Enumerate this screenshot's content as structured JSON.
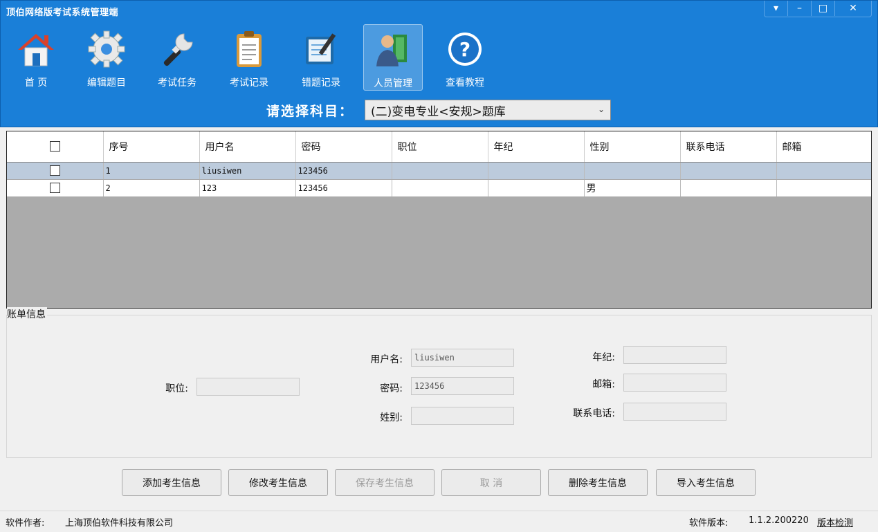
{
  "window": {
    "title": "顶伯网络版考试系统管理端",
    "controls": [
      "▾",
      "–",
      "□",
      "✕"
    ]
  },
  "toolbar": {
    "items": [
      {
        "label": "首  页",
        "icon": "home-icon",
        "active": false
      },
      {
        "label": "编辑题目",
        "icon": "gear-icon",
        "active": false
      },
      {
        "label": "考试任务",
        "icon": "wrench-icon",
        "active": false
      },
      {
        "label": "考试记录",
        "icon": "clipboard-icon",
        "active": false
      },
      {
        "label": "错题记录",
        "icon": "notebook-icon",
        "active": false
      },
      {
        "label": "人员管理",
        "icon": "people-icon",
        "active": true
      },
      {
        "label": "查看教程",
        "icon": "help-icon",
        "active": false
      }
    ]
  },
  "subject": {
    "label": "请选择科目：",
    "selected": "(二)变电专业<安规>题库"
  },
  "grid": {
    "columns": [
      "序号",
      "用户名",
      "密码",
      "职位",
      "年纪",
      "性别",
      "联系电话",
      "邮箱"
    ],
    "rows": [
      {
        "no": "1",
        "username": "liusiwen",
        "password": "123456",
        "position": "",
        "age": "",
        "sex": "",
        "phone": "",
        "email": "",
        "selected": true
      },
      {
        "no": "2",
        "username": "123",
        "password": "123456",
        "position": "",
        "age": "",
        "sex": "男",
        "phone": "",
        "email": "",
        "selected": false
      }
    ]
  },
  "account": {
    "group_label": "账单信息",
    "position_label": "职位:",
    "username_label": "用户名:",
    "username_value": "liusiwen",
    "password_label": "密码:",
    "password_value": "123456",
    "sex_label": "姓别:",
    "age_label": "年纪:",
    "email_label": "邮箱:",
    "phone_label": "联系电话:"
  },
  "buttons": {
    "add": "添加考生信息",
    "modify": "修改考生信息",
    "save": "保存考生信息",
    "cancel": "取  消",
    "delete": "删除考生信息",
    "import": "导入考生信息"
  },
  "status": {
    "author_label": "软件作者:",
    "author_value": "上海顶伯软件科技有限公司",
    "version_label": "软件版本:",
    "version_value": "1.1.2.200220",
    "check_link": "版本检测"
  },
  "colors": {
    "header_blue": "#1a7fd8",
    "selected_row": "#bccbdc",
    "grid_empty": "#ababab"
  }
}
